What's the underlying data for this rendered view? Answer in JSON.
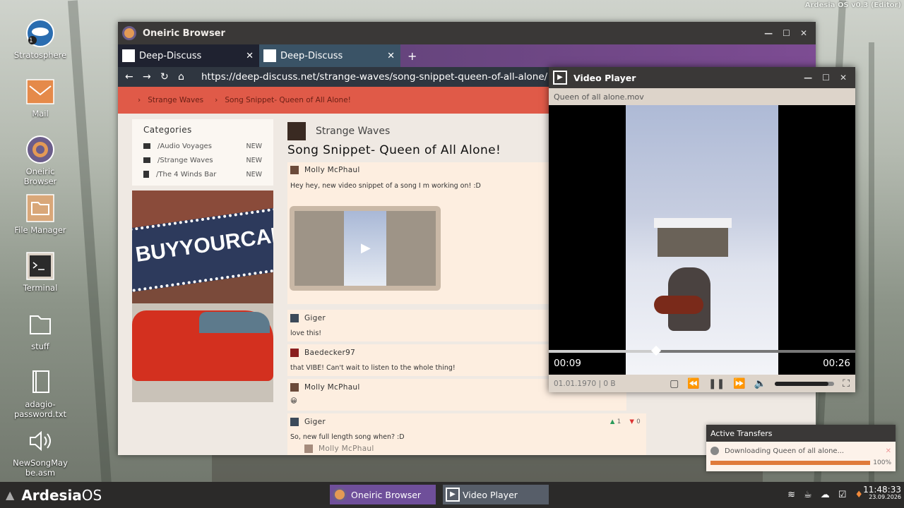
{
  "os": {
    "version": "Ardesia OS v0.3 (Editor)",
    "logo_text_bold": "Ardesia",
    "logo_text_light": "OS"
  },
  "desktop": [
    {
      "label": "Stratosphere",
      "badge": "1"
    },
    {
      "label": "Mail"
    },
    {
      "label": "Oneiric Browser"
    },
    {
      "label": "File Manager"
    },
    {
      "label": "Terminal"
    },
    {
      "label": "stuff"
    },
    {
      "label": "adagio-password.txt"
    },
    {
      "label": "NewSongMaybe.asm"
    }
  ],
  "browser": {
    "title": "Oneiric Browser",
    "tabs": [
      {
        "label": "Deep-Discuss"
      },
      {
        "label": "Deep-Discuss"
      }
    ],
    "new_tab": "+",
    "url": "https://deep-discuss.net/strange-waves/song-snippet-queen-of-all-alone/",
    "breadcrumbs": [
      "Strange Waves",
      "Song Snippet- Queen of All Alone!"
    ],
    "categories": {
      "title": "Categories",
      "items": [
        {
          "name": "/Audio Voyages",
          "badge": "NEW"
        },
        {
          "name": "/Strange Waves",
          "badge": "NEW"
        },
        {
          "name": "/The 4 Winds Bar",
          "badge": "NEW"
        }
      ]
    },
    "ad_text": "BUYYOURCAR.C",
    "forum": {
      "name": "Strange Waves",
      "thread_title": "Song Snippet- Queen of All Alone!"
    },
    "posts": [
      {
        "user": "Molly McPhaul",
        "text": "Hey hey, new video snippet of a song I m working on! :D"
      },
      {
        "user": "Giger",
        "text": "love this!"
      },
      {
        "user": "Baedecker97",
        "text": "that VIBE!  Can't wait to listen to the whole thing!"
      },
      {
        "user": "Molly McPhaul",
        "text": "😀"
      },
      {
        "user": "Giger",
        "text": "So, new full length song when?  :D",
        "up": "1",
        "down": "0"
      },
      {
        "user": "Molly McPhaul",
        "text": ""
      }
    ]
  },
  "player": {
    "title": "Video Player",
    "file": "Queen of all alone.mov",
    "elapsed": "00:09",
    "total": "00:26",
    "progress": 0.35,
    "volume": 0.9,
    "info": "01.01.1970 | 0 B"
  },
  "transfers": {
    "title": "Active Transfers",
    "item": "Downloading Queen of all alone...",
    "percent": "100%",
    "progress": 1.0
  },
  "taskbar": {
    "items": [
      "Oneiric Browser",
      "Video Player"
    ],
    "time": "11:48:33",
    "date": "23.09.2026"
  },
  "colors": {
    "accent_red": "#e05a48",
    "tab_purple": "#7d4c93",
    "taskbar": "#2b2a29",
    "progress_orange": "#e07a3a"
  }
}
